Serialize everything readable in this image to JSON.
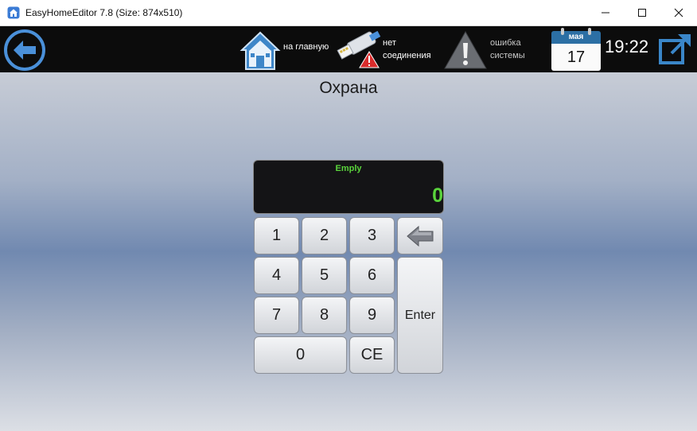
{
  "window": {
    "title": "EasyHomeEditor 7.8 (Size: 874x510)"
  },
  "appbar": {
    "home_label": "на главную",
    "network_label_line1": "нет",
    "network_label_line2": "соединения",
    "error_label_line1": "ошибка",
    "error_label_line2": "системы",
    "calendar_month": "мая",
    "calendar_day": "17",
    "clock": "19:22"
  },
  "page": {
    "title": "Охрана"
  },
  "keypad": {
    "display_status": "Emply",
    "display_value": "0",
    "keys": {
      "k1": "1",
      "k2": "2",
      "k3": "3",
      "k4": "4",
      "k5": "5",
      "k6": "6",
      "k7": "7",
      "k8": "8",
      "k9": "9",
      "k0": "0",
      "ce": "CE",
      "enter": "Enter"
    }
  },
  "colors": {
    "display_text": "#5ad43c",
    "calendar_header": "#2c6fa4",
    "accent_blue": "#3a86c8"
  }
}
